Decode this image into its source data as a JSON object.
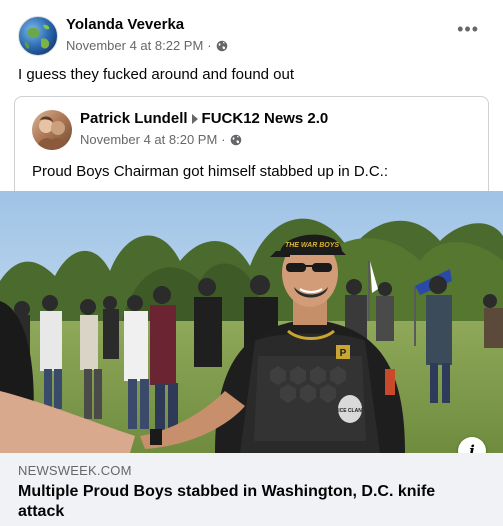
{
  "post": {
    "author": "Yolanda Veverka",
    "timestamp": "November 4 at 8:22 PM",
    "privacy_icon": "globe-icon",
    "more_icon": "more-options-icon",
    "text": "I guess they fucked around and found out"
  },
  "shared": {
    "author": "Patrick Lundell",
    "separator_icon": "triangle-right-icon",
    "group": "FUCK12 News 2.0",
    "timestamp": "November 4 at 8:20 PM",
    "privacy_icon": "globe-icon",
    "text": "Proud Boys Chairman got himself stabbed up in D.C.:"
  },
  "link": {
    "domain": "NEWSWEEK.COM",
    "title": "Multiple Proud Boys stabbed in Washington, D.C. knife attack",
    "info_label": "i",
    "image_text": {
      "cap": "THE WAR BOYS",
      "patch": "P",
      "can": "ICE CLAN"
    }
  },
  "colors": {
    "secondary_text": "#65676b",
    "link_bg": "#f0f2f5",
    "border": "#ced0d4"
  }
}
